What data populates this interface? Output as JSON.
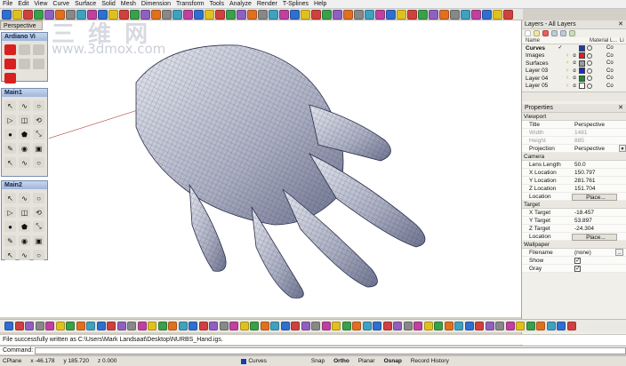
{
  "menu": [
    "File",
    "Edit",
    "View",
    "Curve",
    "Surface",
    "Solid",
    "Mesh",
    "Dimension",
    "Transform",
    "Tools",
    "Analyze",
    "Render",
    "T-Splines",
    "Help"
  ],
  "viewport": {
    "title": "Perspective"
  },
  "watermark": {
    "main": "三 维 网",
    "url": "www.3dmox.com"
  },
  "panels": {
    "ardiano": {
      "title": "Ardiano Vi"
    },
    "main1": {
      "title": "Main1"
    },
    "main2": {
      "title": "Main2"
    }
  },
  "layers": {
    "title": "Layers - All Layers",
    "col_name": "Name",
    "col_material": "Material L...",
    "col_linetype": "Li",
    "rows": [
      {
        "name": "Curves",
        "color": "#1c3da8",
        "current": true,
        "mat": "Co"
      },
      {
        "name": "Images",
        "color": "#e0201c",
        "mat": "Co"
      },
      {
        "name": "Surfaces",
        "color": "#9a9a9a",
        "mat": "Co"
      },
      {
        "name": "Layer 03",
        "color": "#1b2ab8",
        "mat": "Co"
      },
      {
        "name": "Layer 04",
        "color": "#1e8a2a",
        "mat": "Co"
      },
      {
        "name": "Layer 05",
        "color": "#ffffff",
        "mat": "Co"
      }
    ]
  },
  "properties": {
    "title": "Properties",
    "viewport_label": "Viewport",
    "title_key": "Title",
    "title_val": "Perspective",
    "width_key": "Width",
    "width_val": "1481",
    "height_key": "Height",
    "height_val": "885",
    "proj_key": "Projection",
    "proj_val": "Perspective",
    "camera_label": "Camera",
    "lens_key": "Lens Length",
    "lens_val": "50.0",
    "xloc_key": "X Location",
    "xloc_val": "150.797",
    "yloc_key": "Y Location",
    "yloc_val": "281.761",
    "zloc_key": "Z Location",
    "zloc_val": "151.704",
    "loc_key": "Location",
    "place_label": "Place...",
    "target_label": "Target",
    "xt_key": "X Target",
    "xt_val": "-18.457",
    "yt_key": "Y Target",
    "yt_val": "53.897",
    "zt_key": "Z Target",
    "zt_val": "-24.304",
    "tloc_key": "Location",
    "wall_label": "Wallpaper",
    "file_key": "Filename",
    "file_val": "(none)",
    "show_key": "Show",
    "gray_key": "Gray"
  },
  "message": "File successfully written as C:\\Users\\Mark Landsaat\\Desktop\\NURBS_Hand.igs.",
  "command": {
    "label": "Command:",
    "placeholder": ""
  },
  "status": {
    "cplane": "CPlane",
    "x": "x -46.178",
    "y": "y 185.720",
    "z": "z 0.000",
    "layer": "Curves",
    "snap": "Snap",
    "ortho": "Ortho",
    "planar": "Planar",
    "osnap": "Osnap",
    "history": "Record History"
  },
  "colors": {
    "hand_fill": "#c8cbd8",
    "hand_wire": "#2a2f4a",
    "panel_border": "#7a8fb0"
  }
}
